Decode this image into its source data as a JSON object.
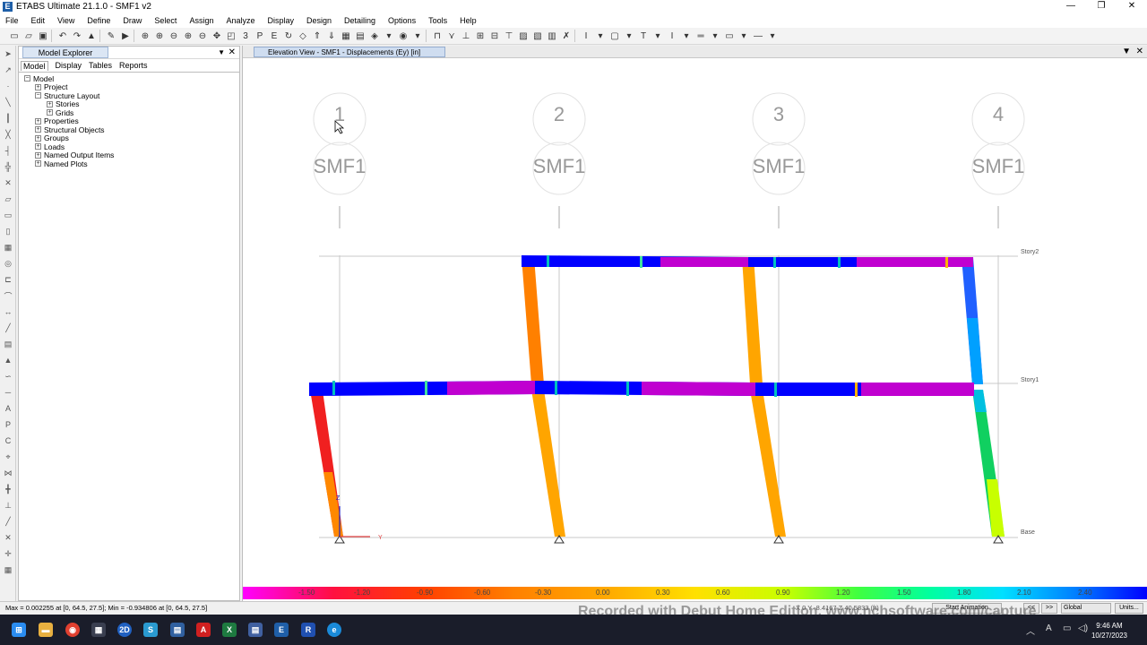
{
  "window": {
    "title": "ETABS Ultimate 21.1.0 - SMF1 v2",
    "app_icon_letter": "E",
    "minimize": "—",
    "restore": "❐",
    "close": "✕"
  },
  "menu": [
    "File",
    "Edit",
    "View",
    "Define",
    "Draw",
    "Select",
    "Assign",
    "Analyze",
    "Display",
    "Design",
    "Detailing",
    "Options",
    "Tools",
    "Help"
  ],
  "explorer": {
    "title": "Model Explorer",
    "pin": "▼",
    "close": "✕",
    "tabs": [
      "Model",
      "Display",
      "Tables",
      "Reports"
    ],
    "tree": [
      {
        "label": "Model",
        "level": 0,
        "toggle": "−"
      },
      {
        "label": "Project",
        "level": 1,
        "toggle": "+"
      },
      {
        "label": "Structure Layout",
        "level": 1,
        "toggle": "−"
      },
      {
        "label": "Stories",
        "level": 2,
        "toggle": "+"
      },
      {
        "label": "Grids",
        "level": 2,
        "toggle": "+"
      },
      {
        "label": "Properties",
        "level": 1,
        "toggle": "+"
      },
      {
        "label": "Structural Objects",
        "level": 1,
        "toggle": "+"
      },
      {
        "label": "Groups",
        "level": 1,
        "toggle": "+"
      },
      {
        "label": "Loads",
        "level": 1,
        "toggle": "+"
      },
      {
        "label": "Named Output Items",
        "level": 1,
        "toggle": "+"
      },
      {
        "label": "Named Plots",
        "level": 1,
        "toggle": "+"
      }
    ]
  },
  "view": {
    "tab_title": "Elevation View - SMF1  - Displacements (Ey)  [in]",
    "pin": "▼",
    "close": "✕",
    "grid_bubbles": [
      "1",
      "2",
      "3",
      "4"
    ],
    "grid_names": [
      "SMF1",
      "SMF1",
      "SMF1",
      "SMF1"
    ],
    "story_labels": [
      "Story2",
      "Story1",
      "Base"
    ],
    "axis_labels": {
      "z": "Z",
      "y": "Y"
    }
  },
  "colorbar": {
    "labels": [
      "-1.50",
      "-1.20",
      "-0.90",
      "-0.60",
      "-0.30",
      "0.00",
      "0.30",
      "0.60",
      "0.90",
      "1.20",
      "1.50",
      "1.80",
      "2.10",
      "2.40"
    ]
  },
  "status": {
    "text": "Max = 0.002255 at [0, 64.5, 27.5];  Min = -0.934806 at [0, 64.5, 27.5]",
    "coords": "X 0  Y -8.4167  Z 40.5833 (ft)",
    "animation_button": "Start Animation",
    "prev_button": "<<",
    "next_button": ">>",
    "coord_system": "Global",
    "units_button": "Units..."
  },
  "watermark": "Recorded with Debut Home Edition. www.nchsoftware.com/capture",
  "taskbar": {
    "time": "9:46 AM",
    "date": "10/27/2023"
  }
}
